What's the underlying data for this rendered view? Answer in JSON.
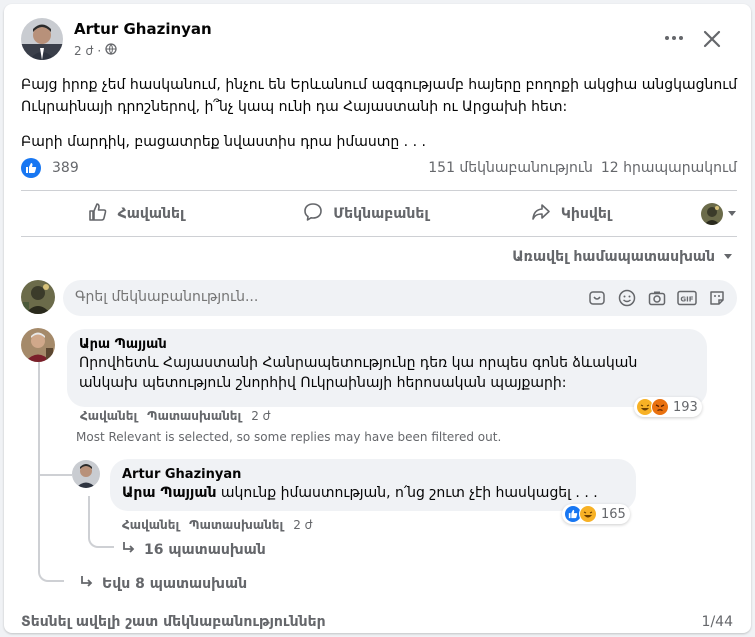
{
  "post": {
    "author": "Artur Ghazinyan",
    "time": "2 ժ",
    "paragraphs": [
      "Բայց իրոք չեմ հասկանում, ինչու են Երևանում ազգությամբ հայերը բողոքի ակցիա անցկացնում Ուկրաինայի դրոշներով, ի՞նչ կապ ունի դա Հայաստանի ու Արցախի հետ:",
      "Բարի մարդիկ, բացատրեք նվաստիս դրա իմաստը . . ."
    ]
  },
  "stats": {
    "likes": "389",
    "comments": "151 մեկնաբանություն",
    "shares": "12 հրապարակում"
  },
  "actions": {
    "like": "Հավանել",
    "comment": "Մեկնաբանել",
    "share": "Կիսվել"
  },
  "sort": {
    "label": "Առավել համապատասխան"
  },
  "composer": {
    "placeholder": "Գրել մեկնաբանություն..."
  },
  "comments": [
    {
      "author": "Արա Պայյան",
      "text": "Որովհետև Հայաստանի Հանրապետությունը դեռ կա որպես գոնե ձևական անկախ պետություն շնորհիվ Ուկրաինայի հերոսական պայքարի:",
      "like": "Հավանել",
      "reply": "Պատասխանել",
      "time": "2 ժ",
      "reactions": "193"
    }
  ],
  "filter_note": "Most Relevant is selected, so some replies may have been filtered out.",
  "reply": {
    "author": "Artur Ghazinyan",
    "mention": "Արա Պայյան",
    "text": " ակունք իմաստության, ո՛նց շուտ չէի հասկացել . . .",
    "like": "Հավանել",
    "reply": "Պատասխանել",
    "time": "2 ժ",
    "reactions": "165"
  },
  "nested_more": "16 պատասխան",
  "more_replies": "Եվս 8 պատասխան",
  "see_more": "Տեսնել ավելի շատ մեկնաբանություններ",
  "pager": "1/44",
  "colors": {
    "accent": "#1877f2",
    "secondary_text": "#65676b",
    "bubble": "#f0f2f5",
    "haha": "#f7b125",
    "angry": "#e9710f"
  },
  "icons": [
    "globe-icon",
    "more-icon",
    "close-icon",
    "like-icon",
    "comment-icon",
    "share-icon",
    "chevron-down-icon",
    "sticker-icon",
    "emoji-icon",
    "camera-icon",
    "gif-icon",
    "avatar-sticker-icon",
    "reply-arrow-icon"
  ]
}
